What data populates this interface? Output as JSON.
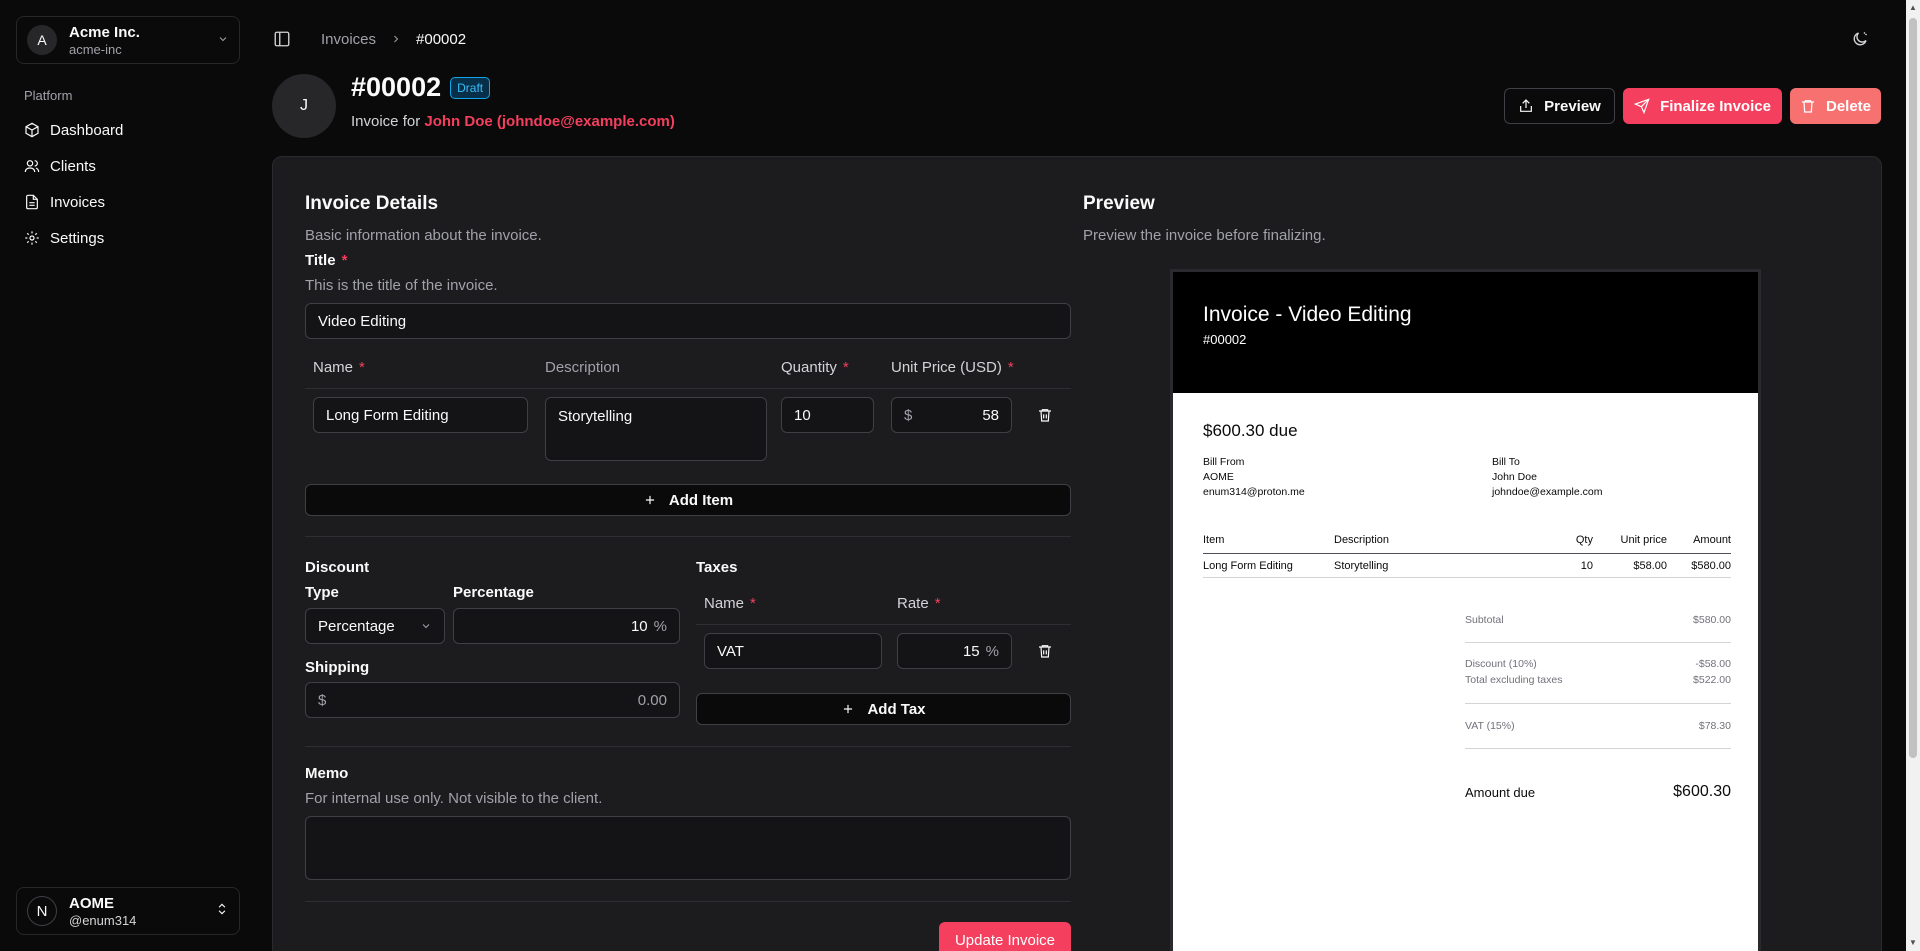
{
  "sidebar": {
    "team": {
      "initial": "A",
      "name": "Acme Inc.",
      "slug": "acme-inc"
    },
    "section_label": "Platform",
    "items": [
      {
        "label": "Dashboard",
        "icon": "cube-icon"
      },
      {
        "label": "Clients",
        "icon": "users-icon"
      },
      {
        "label": "Invoices",
        "icon": "file-icon"
      },
      {
        "label": "Settings",
        "icon": "gear-icon"
      }
    ],
    "user": {
      "initial": "N",
      "name": "AOME",
      "handle": "@enum314"
    }
  },
  "breadcrumb": {
    "parent": "Invoices",
    "current": "#00002"
  },
  "header": {
    "avatar_initial": "J",
    "title": "#00002",
    "status_badge": "Draft",
    "invoice_for_prefix": "Invoice for",
    "client": "John Doe (johndoe@example.com)",
    "preview_label": "Preview",
    "finalize_label": "Finalize Invoice",
    "delete_label": "Delete"
  },
  "form": {
    "title": "Invoice Details",
    "description": "Basic information about the invoice.",
    "title_field": {
      "label": "Title",
      "required": "*",
      "help": "This is the title of the invoice.",
      "value": "Video Editing"
    },
    "items_headers": {
      "name": "Name",
      "description": "Description",
      "quantity": "Quantity",
      "unit_price": "Unit Price (USD)",
      "required": "*"
    },
    "items": [
      {
        "name": "Long Form Editing",
        "description": "Storytelling",
        "quantity": "10",
        "currency": "$",
        "unit_price": "58"
      }
    ],
    "add_item_label": "Add Item",
    "discount": {
      "heading": "Discount",
      "type_label": "Type",
      "type_value": "Percentage",
      "percentage_label": "Percentage",
      "percentage_value": "10",
      "percent_sign": "%"
    },
    "shipping": {
      "label": "Shipping",
      "currency": "$",
      "value": "0.00"
    },
    "taxes": {
      "heading": "Taxes",
      "name_label": "Name",
      "rate_label": "Rate",
      "required": "*",
      "rows": [
        {
          "name": "VAT",
          "rate": "15",
          "percent_sign": "%"
        }
      ],
      "add_tax_label": "Add Tax"
    },
    "memo": {
      "label": "Memo",
      "help": "For internal use only. Not visible to the client.",
      "value": ""
    },
    "update_label": "Update Invoice"
  },
  "preview": {
    "title": "Preview",
    "description": "Preview the invoice before finalizing.",
    "doc": {
      "title": "Invoice - Video Editing",
      "number": "#00002",
      "due": "$600.30 due",
      "bill_from": {
        "label": "Bill From",
        "name": "AOME",
        "email": "enum314@proton.me"
      },
      "bill_to": {
        "label": "Bill To",
        "name": "John Doe",
        "email": "johndoe@example.com"
      },
      "table_headers": {
        "item": "Item",
        "description": "Description",
        "qty": "Qty",
        "unit_price": "Unit price",
        "amount": "Amount"
      },
      "rows": [
        {
          "item": "Long Form Editing",
          "description": "Storytelling",
          "qty": "10",
          "unit_price": "$58.00",
          "amount": "$580.00"
        }
      ],
      "totals": {
        "subtotal_label": "Subtotal",
        "subtotal": "$580.00",
        "discount_label": "Discount (10%)",
        "discount": "-$58.00",
        "excl_label": "Total excluding taxes",
        "excl": "$522.00",
        "vat_label": "VAT (15%)",
        "vat": "$78.30",
        "due_label": "Amount due",
        "due": "$600.30"
      }
    }
  },
  "colors": {
    "accent": "#f43f5e",
    "danger": "#f87171",
    "badge": "#38bdf8",
    "background": "#0a0a0a",
    "card": "#1c1c1e"
  }
}
